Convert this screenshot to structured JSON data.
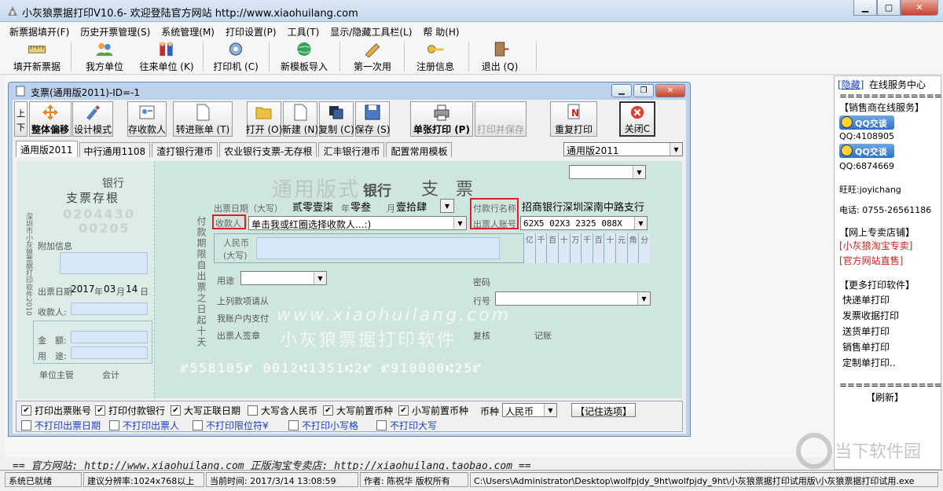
{
  "window": {
    "title": "小灰狼票据打印V10.6- 欢迎登陆官方网站 http://www.xiaohuilang.com"
  },
  "menu": [
    "新票据填开(F)",
    "历史开票管理(S)",
    "系统管理(M)",
    "打印设置(P)",
    "工具(T)",
    "显示/隐藏工具栏(L)",
    "帮 助(H)"
  ],
  "toolbar": [
    "填开新票据",
    "我方单位",
    "往来单位 (K)",
    "打印机 (C)",
    "新模板导入",
    "第一次用",
    "注册信息",
    "退出  (Q)"
  ],
  "child": {
    "title": "支票(通用版2011)-ID=-1",
    "buttons": {
      "up": "上",
      "down": "下",
      "move": "整体偏移",
      "design": "设计模式",
      "payee": "存收款人",
      "transfer": "转进账单 (T)",
      "open": "打开 (O)",
      "new": "新建 (N)",
      "copy": "复制 (C)",
      "save": "保存 (S)",
      "print_single": "单张打印 (P)",
      "print_save": "打印并保存",
      "reprint": "重复打印",
      "close": "关闭C"
    },
    "tabs": [
      "通用版2011",
      "中行通用1108",
      "渣打银行港币",
      "农业银行支票-无存根",
      "汇丰银行港币",
      "配置常用模板"
    ],
    "template_select": "通用版2011"
  },
  "cheque": {
    "stub": {
      "bank": "银行",
      "title": "支票存根",
      "serial": "0204430",
      "serial2": "00205",
      "side_note": "深圳市小灰狼票据打印软件2010",
      "extra": "附加信息",
      "date_label": "出票日期",
      "year": "2017",
      "month": "03",
      "day": "14",
      "year_unit": "年",
      "month_unit": "月",
      "day_unit": "日",
      "payee_label": "收款人:",
      "amount_label": "金　额:",
      "usage_label": "用　途:",
      "manager": "单位主管",
      "accountant": "会计"
    },
    "heading": "通用版式",
    "heading_bank": "银行",
    "heading_type": "支　票",
    "date_label": "出票日期（大写）",
    "year": "贰零壹柒",
    "year_unit": "年",
    "month": "零叁",
    "month_unit": "月",
    "day": "壹拾肆",
    "day_unit": "日",
    "payer_bank_label": "付款行名称",
    "payer_bank": "招商银行深圳深南中路支行",
    "drawer_account_label": "出票人账号",
    "drawer_account": "62X5 02X3 2325 088X",
    "payee_label": "收款人",
    "payee_placeholder": "单击我或红圈选择收款人...:)",
    "rmb_label": "人民币",
    "rmb_caps": "(大写)",
    "digits": [
      "亿",
      "千",
      "百",
      "十",
      "万",
      "千",
      "百",
      "十",
      "元",
      "角",
      "分"
    ],
    "period_text": "付款期限自出票之日起十天",
    "usage_label": "用途",
    "password_label": "密码",
    "line_label": "上列款项请从",
    "line_no_label": "行号",
    "account_pay": "我账户内支付",
    "drawer_sign": "出票人签章",
    "review": "复核",
    "record": "记账",
    "watermark_url": "www.xiaohuilang.com",
    "watermark_cn": "小灰狼票据打印软件",
    "micr": "⑈558105⑈ 0012⑆1351⑆2⑈  ⑈910000⑆25⑈"
  },
  "options": {
    "row1": [
      {
        "label": "打印出票账号",
        "checked": true
      },
      {
        "label": "打印付款银行",
        "checked": true
      },
      {
        "label": "大写正联日期",
        "checked": true
      },
      {
        "label": "大写含人民币",
        "checked": false
      },
      {
        "label": "大写前置币种",
        "checked": true
      },
      {
        "label": "小写前置币种",
        "checked": true
      }
    ],
    "currency_label": "币种",
    "currency": "人民币",
    "remember": "【记住选项】",
    "row2": [
      "不打印出票日期",
      "不打印出票人",
      "不打印限位符¥",
      "不打印小写格",
      "不打印大写"
    ]
  },
  "sidebar": {
    "hide": "[隐藏]",
    "title": "在线服务中心",
    "sep": "================",
    "dealer": "【销售商在线服务】",
    "qq_btn": "QQ交谈",
    "qq1": "QQ:4108905",
    "qq2": "QQ:6874669",
    "wangwang": "旺旺:joyichang",
    "phone": "电话: 0755-26561186",
    "shop_title": "【网上专卖店铺】",
    "shop1": "[小灰狼淘宝专卖]",
    "shop2": "[官方网站直售]",
    "more_title": "【更多打印软件】",
    "more": [
      "快递单打印",
      "发票收据打印",
      "送货单打印",
      "销售单打印",
      "定制单打印.."
    ],
    "refresh": "【刷新】"
  },
  "footer": "== 官方网站: http://www.xiaohuilang.com 正版淘宝专卖店: http://xiaohuilang.taobao.com ==",
  "status": {
    "ready": "系统已就绪",
    "res": "建议分辨率:1024x768以上",
    "time": "当前时间: 2017/3/14 13:08:59",
    "author": "作者: 陈祝华 版权所有",
    "path": "C:\\Users\\Administrator\\Desktop\\wolfpjdy_9ht\\wolfpjdy_9ht\\小灰狼票据打印试用版\\小灰狼票据打印试用.exe"
  },
  "brand_watermark": "当下软件园"
}
